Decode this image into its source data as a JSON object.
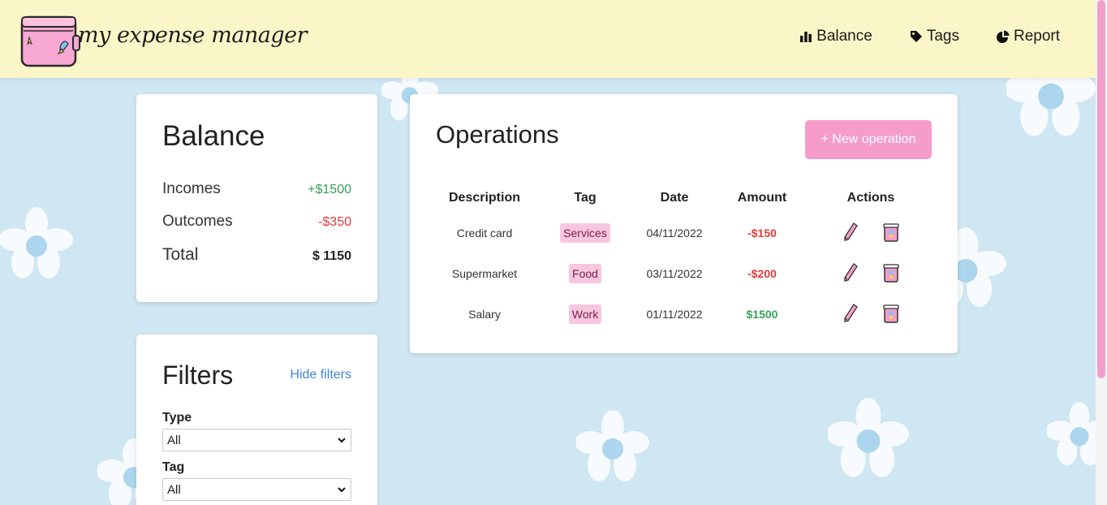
{
  "header": {
    "logo_text": "my expense manager",
    "nav": [
      {
        "label": "Balance",
        "icon": "bar-chart-icon"
      },
      {
        "label": "Tags",
        "icon": "tag-icon"
      },
      {
        "label": "Report",
        "icon": "pie-chart-icon"
      }
    ]
  },
  "balance": {
    "title": "Balance",
    "incomes_label": "Incomes",
    "incomes_value": "+$1500",
    "outcomes_label": "Outcomes",
    "outcomes_value": "-$350",
    "total_label": "Total",
    "total_value": "$ 1150"
  },
  "filters": {
    "title": "Filters",
    "hide_link": "Hide filters",
    "type_label": "Type",
    "type_value": "All",
    "tag_label": "Tag",
    "tag_value": "All"
  },
  "operations": {
    "title": "Operations",
    "new_button": "+ New operation",
    "columns": [
      "Description",
      "Tag",
      "Date",
      "Amount",
      "Actions"
    ],
    "rows": [
      {
        "description": "Credit card",
        "tag": "Services",
        "date": "04/11/2022",
        "amount": "-$150",
        "type": "outcome"
      },
      {
        "description": "Supermarket",
        "tag": "Food",
        "date": "03/11/2022",
        "amount": "-$200",
        "type": "outcome"
      },
      {
        "description": "Salary",
        "tag": "Work",
        "date": "01/11/2022",
        "amount": "$1500",
        "type": "income"
      }
    ]
  },
  "colors": {
    "header_bg": "#fbf6c8",
    "page_bg": "#cfe6f3",
    "accent_pink": "#f59ccb",
    "income_green": "#3aa05a",
    "outcome_red": "#e03b3b",
    "link_blue": "#3e86d6"
  }
}
